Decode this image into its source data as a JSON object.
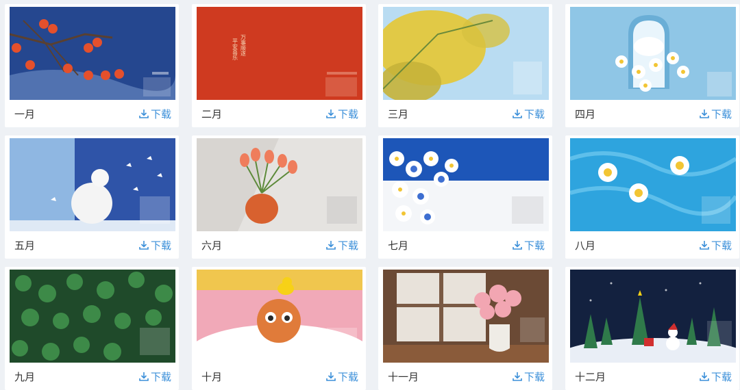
{
  "cards": [
    {
      "month": "一月",
      "download_label": "下载",
      "icon": "download-icon"
    },
    {
      "month": "二月",
      "download_label": "下载",
      "icon": "download-icon",
      "image_text": [
        "万事顺遂",
        "平安喜乐"
      ]
    },
    {
      "month": "三月",
      "download_label": "下载",
      "icon": "download-icon"
    },
    {
      "month": "四月",
      "download_label": "下载",
      "icon": "download-icon"
    },
    {
      "month": "五月",
      "download_label": "下载",
      "icon": "download-icon"
    },
    {
      "month": "六月",
      "download_label": "下载",
      "icon": "download-icon"
    },
    {
      "month": "七月",
      "download_label": "下载",
      "icon": "download-icon"
    },
    {
      "month": "八月",
      "download_label": "下载",
      "icon": "download-icon"
    },
    {
      "month": "九月",
      "download_label": "下载",
      "icon": "download-icon"
    },
    {
      "month": "十月",
      "download_label": "下载",
      "icon": "download-icon"
    },
    {
      "month": "十一月",
      "download_label": "下载",
      "icon": "download-icon"
    },
    {
      "month": "十二月",
      "download_label": "下载",
      "icon": "download-icon"
    }
  ],
  "colors": {
    "accent": "#3b8fd9",
    "page_bg": "#eef1f5",
    "card_bg": "#ffffff",
    "text": "#333333"
  }
}
